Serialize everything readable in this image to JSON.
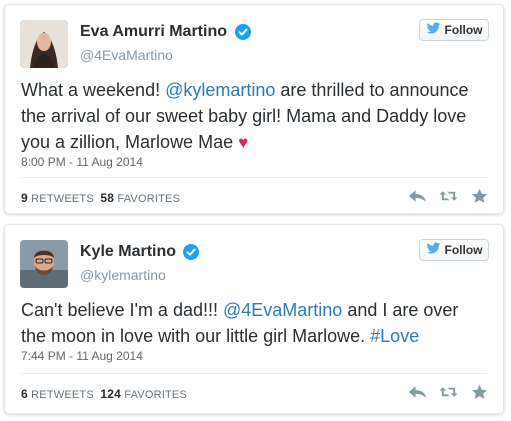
{
  "tweets": [
    {
      "name": "Eva Amurri Martino",
      "handle": "@4EvaMartino",
      "follow_label": "Follow",
      "text_parts": {
        "p1": "What a weekend! ",
        "mention": "@kylemartino",
        "p2": " are thrilled to announce the arrival of our sweet baby girl! Mama and Daddy love you a zillion, Marlowe Mae ",
        "emoji": "♥"
      },
      "timestamp": "8:00 PM - 11 Aug 2014",
      "retweets_count": "9",
      "retweets_label": "RETWEETS",
      "favorites_count": "58",
      "favorites_label": "FAVORITES"
    },
    {
      "name": "Kyle Martino",
      "handle": "@kylemartino",
      "follow_label": "Follow",
      "text_parts": {
        "p1": "Can't believe I'm a dad!!! ",
        "mention": "@4EvaMartino",
        "p2": " and I are over the moon in love with our little girl Marlowe. ",
        "hashtag": "#Love"
      },
      "timestamp": "7:44 PM - 11 Aug 2014",
      "retweets_count": "6",
      "retweets_label": "RETWEETS",
      "favorites_count": "124",
      "favorites_label": "FAVORITES"
    }
  ],
  "colors": {
    "link": "#2b7bb9",
    "verified": "#1da1f2",
    "twitter_bird": "#55acee",
    "heart": "#e0245e",
    "action_icon": "#8899a6"
  },
  "icons": [
    "verified-badge-icon",
    "twitter-bird-icon",
    "reply-icon",
    "retweet-icon",
    "favorite-star-icon"
  ]
}
